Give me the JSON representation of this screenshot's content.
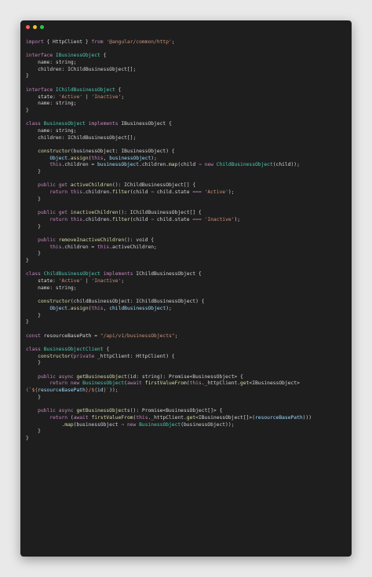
{
  "window": {
    "traffic_lights": [
      {
        "name": "close",
        "color": "#ff5f56"
      },
      {
        "name": "minimize",
        "color": "#ffbd2e"
      },
      {
        "name": "maximize",
        "color": "#27c93f"
      }
    ],
    "background": "#1e1e1e"
  },
  "code_lines": [
    [
      [
        "kw",
        "import"
      ],
      [
        "text",
        " { HttpClient } "
      ],
      [
        "kw",
        "from"
      ],
      [
        "text",
        " "
      ],
      [
        "str",
        "'@angular/common/http'"
      ],
      [
        "text",
        ";"
      ]
    ],
    [],
    [
      [
        "kw",
        "interface"
      ],
      [
        "text",
        " "
      ],
      [
        "type",
        "IBusinessObject"
      ],
      [
        "text",
        " {"
      ]
    ],
    [
      [
        "text",
        "    name: string;"
      ]
    ],
    [
      [
        "text",
        "    children: IChildBusinessObject[];"
      ]
    ],
    [
      [
        "text",
        "}"
      ]
    ],
    [],
    [
      [
        "kw",
        "interface"
      ],
      [
        "text",
        " "
      ],
      [
        "type",
        "IChildBusinessObject"
      ],
      [
        "text",
        " {"
      ]
    ],
    [
      [
        "text",
        "    state: "
      ],
      [
        "str",
        "'Active'"
      ],
      [
        "text",
        " | "
      ],
      [
        "str",
        "'Inactive'"
      ],
      [
        "text",
        ";"
      ]
    ],
    [
      [
        "text",
        "    name: string;"
      ]
    ],
    [
      [
        "text",
        "}"
      ]
    ],
    [],
    [
      [
        "kw",
        "class"
      ],
      [
        "text",
        " "
      ],
      [
        "type",
        "BusinessObject"
      ],
      [
        "text",
        " "
      ],
      [
        "kw",
        "implements"
      ],
      [
        "text",
        " IBusinessObject {"
      ]
    ],
    [
      [
        "text",
        "    name: string;"
      ]
    ],
    [
      [
        "text",
        "    children: IChildBusinessObject[];"
      ]
    ],
    [],
    [
      [
        "text",
        "    "
      ],
      [
        "fn",
        "constructor"
      ],
      [
        "text",
        "(businessObject: IBusinessObject) {"
      ]
    ],
    [
      [
        "text",
        "        "
      ],
      [
        "var",
        "Object"
      ],
      [
        "text",
        "."
      ],
      [
        "fn",
        "assign"
      ],
      [
        "text",
        "("
      ],
      [
        "kw",
        "this"
      ],
      [
        "text",
        ", "
      ],
      [
        "var",
        "businessObject"
      ],
      [
        "text",
        ");"
      ]
    ],
    [
      [
        "text",
        "        "
      ],
      [
        "kw",
        "this"
      ],
      [
        "text",
        ".children = "
      ],
      [
        "var",
        "businessObject"
      ],
      [
        "text",
        ".children."
      ],
      [
        "fn",
        "map"
      ],
      [
        "text",
        "(child "
      ],
      [
        "kw",
        "⇒"
      ],
      [
        "text",
        " "
      ],
      [
        "kw",
        "new"
      ],
      [
        "text",
        " "
      ],
      [
        "type",
        "ChildBusinessObject"
      ],
      [
        "text",
        "(child));"
      ]
    ],
    [
      [
        "text",
        "    }"
      ]
    ],
    [],
    [
      [
        "text",
        "    "
      ],
      [
        "kw",
        "public"
      ],
      [
        "text",
        " "
      ],
      [
        "kw",
        "get"
      ],
      [
        "text",
        " "
      ],
      [
        "fn",
        "activeChildren"
      ],
      [
        "text",
        "(): IChildBusinessObject[] {"
      ]
    ],
    [
      [
        "text",
        "        "
      ],
      [
        "kw",
        "return"
      ],
      [
        "text",
        " "
      ],
      [
        "kw",
        "this"
      ],
      [
        "text",
        ".children."
      ],
      [
        "fn",
        "filter"
      ],
      [
        "text",
        "(child "
      ],
      [
        "kw",
        "⇒"
      ],
      [
        "text",
        " child.state "
      ],
      [
        "kw",
        "==="
      ],
      [
        "text",
        " "
      ],
      [
        "str",
        "'Active'"
      ],
      [
        "text",
        ");"
      ]
    ],
    [
      [
        "text",
        "    }"
      ]
    ],
    [],
    [
      [
        "text",
        "    "
      ],
      [
        "kw",
        "public"
      ],
      [
        "text",
        " "
      ],
      [
        "kw",
        "get"
      ],
      [
        "text",
        " "
      ],
      [
        "fn",
        "inactiveChildren"
      ],
      [
        "text",
        "(): IChildBusinessObject[] {"
      ]
    ],
    [
      [
        "text",
        "        "
      ],
      [
        "kw",
        "return"
      ],
      [
        "text",
        " "
      ],
      [
        "kw",
        "this"
      ],
      [
        "text",
        ".children."
      ],
      [
        "fn",
        "filter"
      ],
      [
        "text",
        "(child "
      ],
      [
        "kw",
        "⇒"
      ],
      [
        "text",
        " child.state "
      ],
      [
        "kw",
        "==="
      ],
      [
        "text",
        " "
      ],
      [
        "str",
        "'Inactive'"
      ],
      [
        "text",
        ");"
      ]
    ],
    [
      [
        "text",
        "    }"
      ]
    ],
    [],
    [
      [
        "text",
        "    "
      ],
      [
        "kw",
        "public"
      ],
      [
        "text",
        " "
      ],
      [
        "fn",
        "removeInactiveChildren"
      ],
      [
        "text",
        "(): void {"
      ]
    ],
    [
      [
        "text",
        "        "
      ],
      [
        "kw",
        "this"
      ],
      [
        "text",
        ".children = "
      ],
      [
        "kw",
        "this"
      ],
      [
        "text",
        ".activeChildren;"
      ]
    ],
    [
      [
        "text",
        "    }"
      ]
    ],
    [
      [
        "text",
        "}"
      ]
    ],
    [],
    [
      [
        "kw",
        "class"
      ],
      [
        "text",
        " "
      ],
      [
        "type",
        "ChildBusinessObject"
      ],
      [
        "text",
        " "
      ],
      [
        "kw",
        "implements"
      ],
      [
        "text",
        " IChildBusinessObject {"
      ]
    ],
    [
      [
        "text",
        "    state: "
      ],
      [
        "str",
        "'Active'"
      ],
      [
        "text",
        " | "
      ],
      [
        "str",
        "'Inactive'"
      ],
      [
        "text",
        ";"
      ]
    ],
    [
      [
        "text",
        "    name: string;"
      ]
    ],
    [],
    [
      [
        "text",
        "    "
      ],
      [
        "fn",
        "constructor"
      ],
      [
        "text",
        "(childBusinessObject: IChildBusinessObject) {"
      ]
    ],
    [
      [
        "text",
        "        "
      ],
      [
        "var",
        "Object"
      ],
      [
        "text",
        "."
      ],
      [
        "fn",
        "assign"
      ],
      [
        "text",
        "("
      ],
      [
        "kw",
        "this"
      ],
      [
        "text",
        ", "
      ],
      [
        "var",
        "childBusinessObject"
      ],
      [
        "text",
        ");"
      ]
    ],
    [
      [
        "text",
        "    }"
      ]
    ],
    [
      [
        "text",
        "}"
      ]
    ],
    [],
    [
      [
        "kw",
        "const"
      ],
      [
        "text",
        " resourceBasePath = "
      ],
      [
        "str",
        "\"/api/v1/businessObjects\""
      ],
      [
        "text",
        ";"
      ]
    ],
    [],
    [
      [
        "kw",
        "class"
      ],
      [
        "text",
        " "
      ],
      [
        "type",
        "BusinessObjectClient"
      ],
      [
        "text",
        " {"
      ]
    ],
    [
      [
        "text",
        "    "
      ],
      [
        "fn",
        "constructor"
      ],
      [
        "text",
        "("
      ],
      [
        "kw",
        "private"
      ],
      [
        "text",
        " _httpClient: HttpClient) {"
      ]
    ],
    [
      [
        "text",
        "    }"
      ]
    ],
    [],
    [
      [
        "text",
        "    "
      ],
      [
        "kw",
        "public"
      ],
      [
        "text",
        " "
      ],
      [
        "kw",
        "async"
      ],
      [
        "text",
        " "
      ],
      [
        "fn",
        "getBusinessObject"
      ],
      [
        "text",
        "(id: string): Promise<BusinessObject> {"
      ]
    ],
    [
      [
        "text",
        "        "
      ],
      [
        "kw",
        "return"
      ],
      [
        "text",
        " "
      ],
      [
        "kw",
        "new"
      ],
      [
        "text",
        " "
      ],
      [
        "type",
        "BusinessObject"
      ],
      [
        "text",
        "("
      ],
      [
        "kw",
        "await"
      ],
      [
        "text",
        " "
      ],
      [
        "fn",
        "firstValueFrom"
      ],
      [
        "text",
        "("
      ],
      [
        "kw",
        "this"
      ],
      [
        "text",
        "._httpClient."
      ],
      [
        "fn",
        "get"
      ],
      [
        "text",
        "<IBusinessObject>"
      ]
    ],
    [
      [
        "str",
        "(`${"
      ],
      [
        "var",
        "resourceBasePath"
      ],
      [
        "str",
        "}/${"
      ],
      [
        "var",
        "id"
      ],
      [
        "str",
        "}`"
      ],
      [
        "text",
        "));"
      ]
    ],
    [
      [
        "text",
        "    }"
      ]
    ],
    [],
    [
      [
        "text",
        "    "
      ],
      [
        "kw",
        "public"
      ],
      [
        "text",
        " "
      ],
      [
        "kw",
        "async"
      ],
      [
        "text",
        " "
      ],
      [
        "fn",
        "getBusinessObjects"
      ],
      [
        "text",
        "(): Promise<BusinessObject[]> {"
      ]
    ],
    [
      [
        "text",
        "        "
      ],
      [
        "kw",
        "return"
      ],
      [
        "text",
        " ("
      ],
      [
        "kw",
        "await"
      ],
      [
        "text",
        " "
      ],
      [
        "fn",
        "firstValueFrom"
      ],
      [
        "text",
        "("
      ],
      [
        "kw",
        "this"
      ],
      [
        "text",
        "._httpClient."
      ],
      [
        "fn",
        "get"
      ],
      [
        "text",
        "<IBusinessObject[]>("
      ],
      [
        "var",
        "resourceBasePath"
      ],
      [
        "text",
        ")))"
      ]
    ],
    [
      [
        "text",
        "            ."
      ],
      [
        "fn",
        "map"
      ],
      [
        "text",
        "(businessObject "
      ],
      [
        "kw",
        "⇒"
      ],
      [
        "text",
        " "
      ],
      [
        "kw",
        "new"
      ],
      [
        "text",
        " "
      ],
      [
        "type",
        "BusinessObject"
      ],
      [
        "text",
        "(businessObject));"
      ]
    ],
    [
      [
        "text",
        "    }"
      ]
    ],
    [
      [
        "text",
        "}"
      ]
    ]
  ]
}
